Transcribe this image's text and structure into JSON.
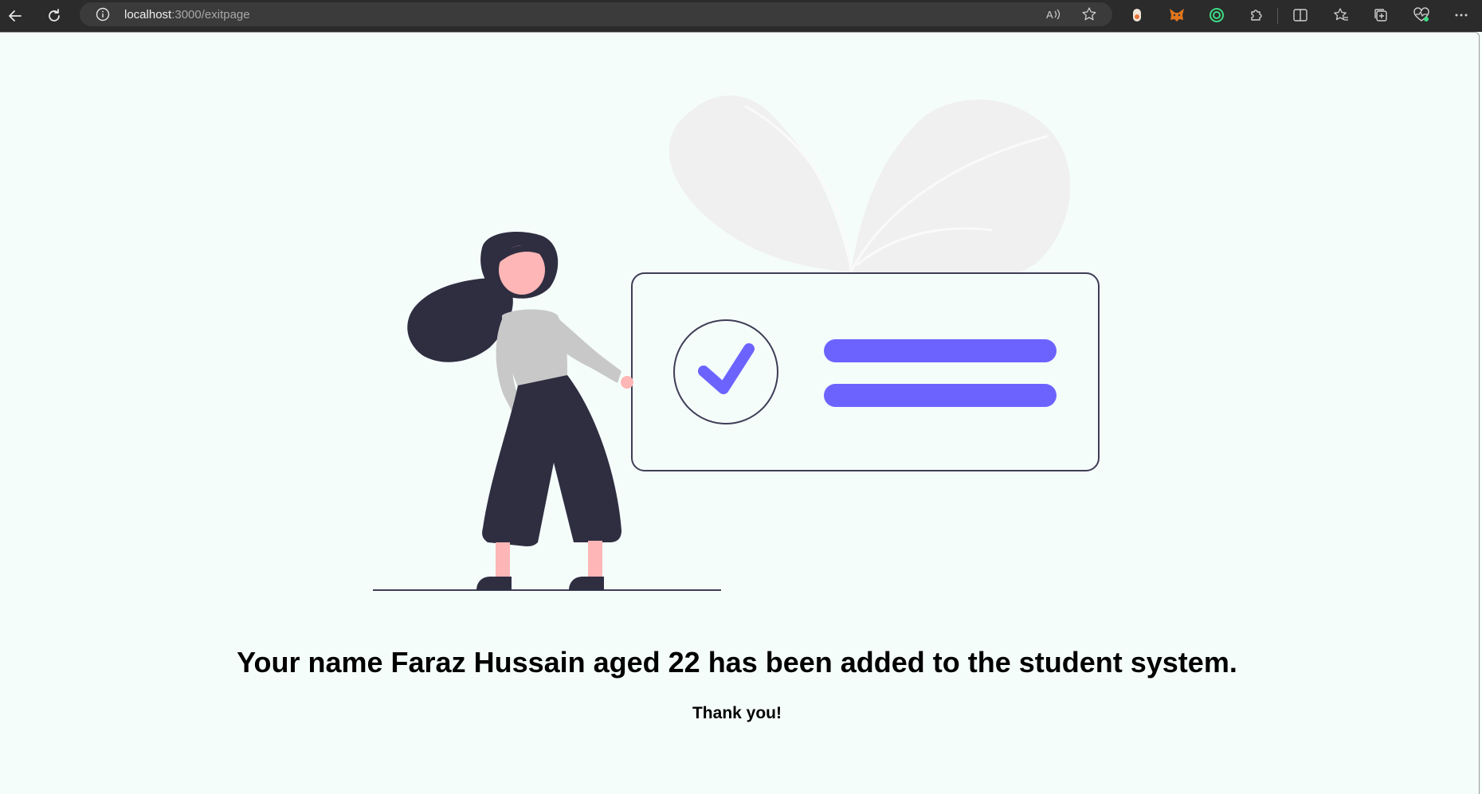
{
  "browser": {
    "url_host": "localhost",
    "url_path": ":3000/exitpage",
    "icons": [
      "back-icon",
      "reload-icon",
      "site-info-icon",
      "read-aloud-icon",
      "favorite-star-icon",
      "extension-icon",
      "metamask-icon",
      "extension-ring-icon",
      "puzzle-icon",
      "split-screen-icon",
      "favorites-icon",
      "collections-icon",
      "health-icon",
      "more-icon"
    ]
  },
  "main": {
    "message": "Your name Faraz Hussain aged 22 has been added to the student system.",
    "thanks": "Thank you!"
  },
  "colors": {
    "accent": "#6c63ff",
    "dark": "#2f2e41",
    "background": "#f5fdfb"
  }
}
